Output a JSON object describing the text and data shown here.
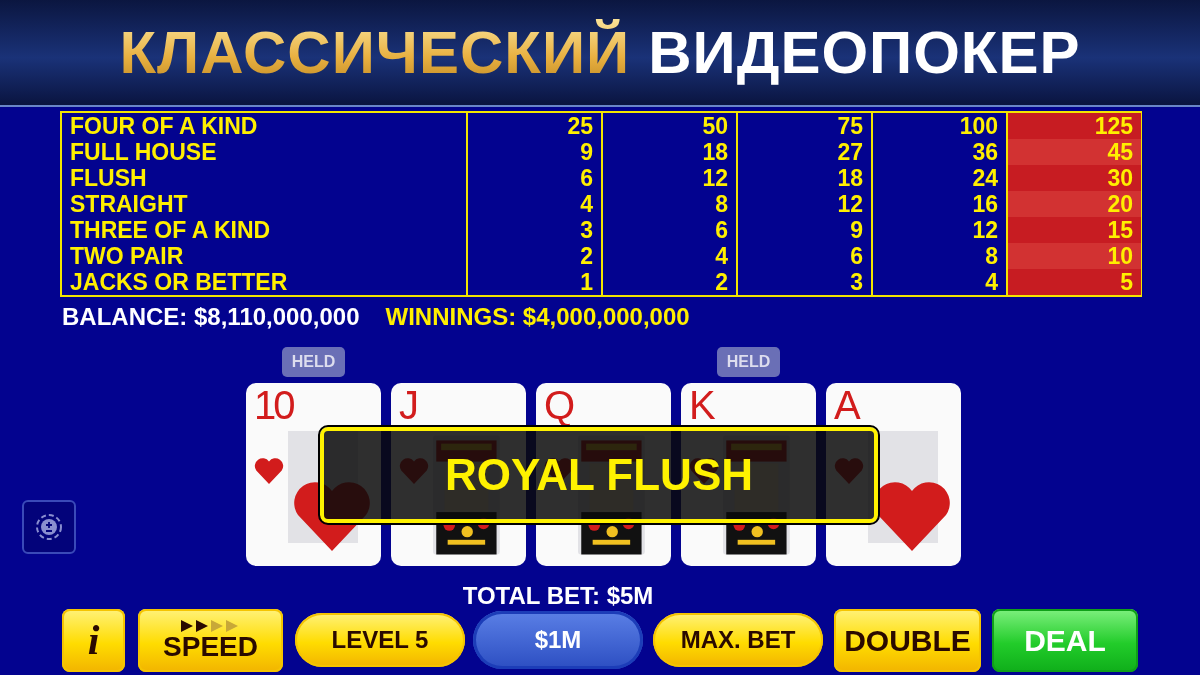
{
  "banner": {
    "title_gold": "КЛАССИЧЕСКИЙ",
    "title_white": "ВИДЕОПОКЕР"
  },
  "paytable": {
    "columns": [
      {
        "selected": false
      },
      {
        "selected": false
      },
      {
        "selected": false
      },
      {
        "selected": false
      },
      {
        "selected": true
      }
    ],
    "rows": [
      {
        "hand": "FOUR OF A KIND",
        "payouts": [
          "25",
          "50",
          "75",
          "100",
          "125"
        ]
      },
      {
        "hand": "FULL HOUSE",
        "payouts": [
          "9",
          "18",
          "27",
          "36",
          "45"
        ]
      },
      {
        "hand": "FLUSH",
        "payouts": [
          "6",
          "12",
          "18",
          "24",
          "30"
        ]
      },
      {
        "hand": "STRAIGHT",
        "payouts": [
          "4",
          "8",
          "12",
          "16",
          "20"
        ]
      },
      {
        "hand": "THREE OF A KIND",
        "payouts": [
          "3",
          "6",
          "9",
          "12",
          "15"
        ]
      },
      {
        "hand": "TWO PAIR",
        "payouts": [
          "2",
          "4",
          "6",
          "8",
          "10"
        ]
      },
      {
        "hand": "JACKS OR BETTER",
        "payouts": [
          "1",
          "2",
          "3",
          "4",
          "5"
        ]
      }
    ]
  },
  "balance": "BALANCE: $8,110,000,000",
  "winnings": "WINNINGS: $4,000,000,000",
  "cards": [
    {
      "rank": "10",
      "kind": "pip",
      "badge": "HELD"
    },
    {
      "rank": "J",
      "kind": "face"
    },
    {
      "rank": "Q",
      "kind": "face"
    },
    {
      "rank": "K",
      "kind": "face",
      "badge": "HELD"
    },
    {
      "rank": "A",
      "kind": "pip"
    }
  ],
  "result": "ROYAL FLUSH",
  "total_bet": "TOTAL BET: $5M",
  "buttons": [
    {
      "kind": "info",
      "label": "i"
    },
    {
      "kind": "speed",
      "label": "SPEED",
      "level": 0.5
    },
    {
      "kind": "pill",
      "label": "LEVEL 5"
    },
    {
      "kind": "blue",
      "label": "$1M"
    },
    {
      "kind": "pill",
      "label": "MAX. BET"
    },
    {
      "kind": "square",
      "label": "DOUBLE"
    },
    {
      "kind": "deal",
      "label": "DEAL"
    }
  ]
}
